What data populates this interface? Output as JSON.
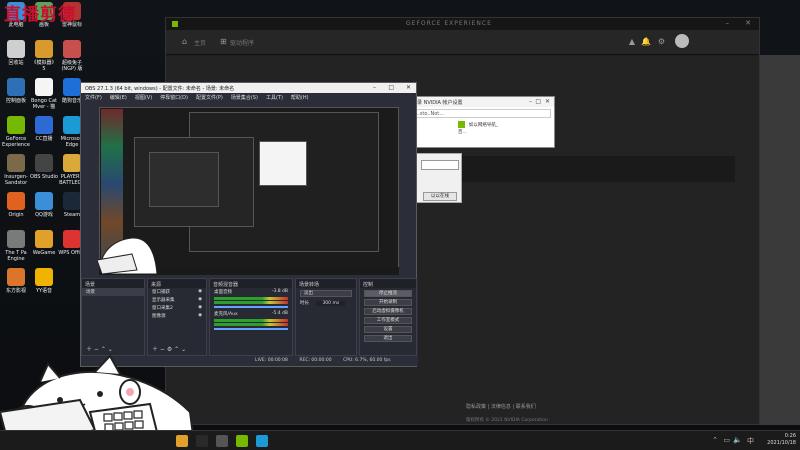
{
  "desktop": {
    "watermark_text": "直播剪德",
    "icons": [
      {
        "label": "此电脑",
        "color": "#3a8fd8"
      },
      {
        "label": "画板",
        "color": "#5ba55b"
      },
      {
        "label": "雷神鼠标",
        "color": "#b33232"
      },
      {
        "label": "回收站",
        "color": "#cfcfcf"
      },
      {
        "label": "《模拟器》5",
        "color": "#d89a2c"
      },
      {
        "label": "超级兔子(NGP) 版",
        "color": "#c94e4e"
      },
      {
        "label": "控制面板",
        "color": "#2e6fb8"
      },
      {
        "label": "Bongo Cat Mver - 猫",
        "color": "#f5f5f5"
      },
      {
        "label": "酷狗音乐",
        "color": "#1d6fd9"
      },
      {
        "label": "GeForce Experience",
        "color": "#76b900"
      },
      {
        "label": "CC直播",
        "color": "#2d6ad6"
      },
      {
        "label": "Microsoft Edge",
        "color": "#1b9ad6"
      },
      {
        "label": "Insurgen- Sandstor",
        "color": "#7a6a4a"
      },
      {
        "label": "OBS Studio",
        "color": "#444444"
      },
      {
        "label": "PLAYERU BATTLEGR",
        "color": "#d9a93a"
      },
      {
        "label": "Origin",
        "color": "#e0621f"
      },
      {
        "label": "QQ游戏",
        "color": "#3a8fd8"
      },
      {
        "label": "Steam",
        "color": "#1b2838"
      },
      {
        "label": "The T Pa Engine",
        "color": "#7a7a7a"
      },
      {
        "label": "WeGame",
        "color": "#e0a02a"
      },
      {
        "label": "WPS Office",
        "color": "#d33"
      },
      {
        "label": "东方影视",
        "color": "#d9762c"
      },
      {
        "label": "YY语音",
        "color": "#f0b400"
      }
    ]
  },
  "geforce": {
    "title": "GEFORCE EXPERIENCE",
    "nav_home": "主页",
    "nav_drivers": "驱动程序",
    "footer_links": "隐私政策  |  法律信息  |  联系我们",
    "copyright": "版权所有 © 2021 NVIDIA Corporation"
  },
  "nv_dialog": {
    "title": "登录 NVIDIA 帐户设置",
    "address": "...sto..Not...",
    "favorite": "如以网络导航_百...",
    "side_button": "以以在线"
  },
  "obs": {
    "title": "OBS 27.1.3 (64 bit, windows) - 配置文件: 未命名 - 场景: 未命名",
    "menu": [
      "文件(F)",
      "编辑(E)",
      "视图(V)",
      "停靠窗口(D)",
      "配置文件(P)",
      "场景集合(S)",
      "工具(T)",
      "帮助(H)"
    ],
    "docks": {
      "scenes_title": "场景",
      "scene_item": "场景",
      "sources_title": "来源",
      "sources": [
        "窗口捕获",
        "显示器采集",
        "窗口采集2",
        "图像源"
      ],
      "mixer_title": "音频混音器",
      "mixer_tracks": [
        {
          "name": "桌面音频",
          "db": "-3.8 dB"
        },
        {
          "name": "麦克风/Aux",
          "db": "-5.4 dB"
        }
      ],
      "transitions_title": "场景转场",
      "transition_type": "淡出",
      "duration_label": "时长",
      "duration_value": "300 ms",
      "controls_title": "控制",
      "controls": [
        "停止推流",
        "开始录制",
        "启动虚拟摄像机",
        "工作室模式",
        "设置",
        "退出"
      ]
    },
    "status": {
      "live": "LIVE: 00:00:08",
      "rec": "REC: 00:00:00",
      "cpu": "CPU: 6.7%, 60.00 fps",
      "kbps": "kb/s: 2500"
    },
    "filter_btn": "滤镜"
  },
  "taskbar": {
    "time": "0:26",
    "date": "2021/10/18",
    "icons": [
      {
        "name": "start",
        "color": "#2a2a2a"
      },
      {
        "name": "obs",
        "color": "#555555"
      },
      {
        "name": "geforce",
        "color": "#76b900"
      },
      {
        "name": "edge",
        "color": "#1b9ad6"
      },
      {
        "name": "folder",
        "color": "#e0a02a"
      }
    ]
  }
}
